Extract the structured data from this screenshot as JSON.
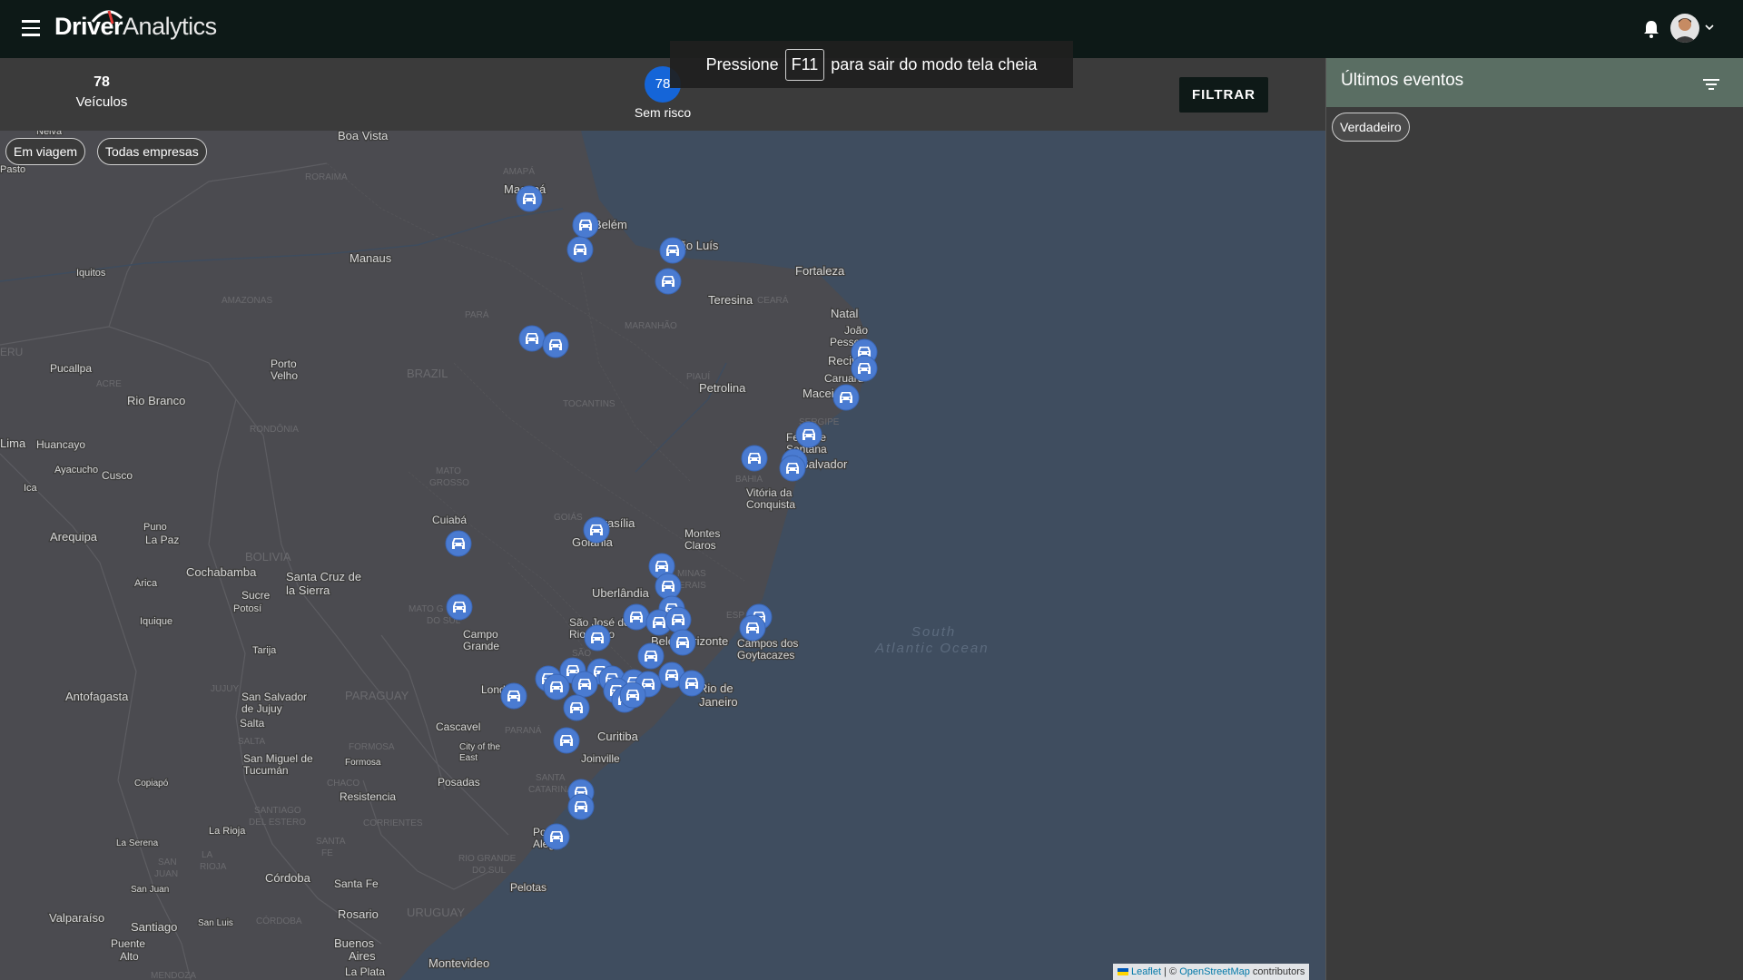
{
  "header": {
    "logo_bold": "Driver",
    "logo_light": "Analytics",
    "icons": [
      "menu-icon",
      "bell-icon",
      "avatar",
      "chevron-down-icon"
    ]
  },
  "stats": {
    "vehicles_count": "78",
    "vehicles_label": "Veículos",
    "risk_count": "78",
    "risk_label": "Sem risco"
  },
  "toolbar": {
    "filter_label": "FILTRAR"
  },
  "fullscreen_notice": {
    "before": "Pressione",
    "key": "F11",
    "after": "para sair do modo tela cheia"
  },
  "map": {
    "chips": [
      "Em viagem",
      "Todas empresas"
    ],
    "attribution": {
      "leaflet": "Leaflet",
      "separator": "| ©",
      "osm": "OpenStreetMap",
      "suffix": "contributors"
    },
    "marker_color": "#4a7bd1",
    "labels_cities": [
      "Boa Vista",
      "Macapá",
      "Belém",
      "São Luís",
      "Fortaleza",
      "Manaus",
      "Iquitos",
      "Teresina",
      "Natal",
      "João Pessoa",
      "Recife",
      "Caruaru",
      "Maceió",
      "Porto Velho",
      "Rio Branco",
      "Pucallpa",
      "Petrolina",
      "Feira de Santana",
      "Salvador",
      "Vitória da Conquista",
      "Lima",
      "Huancayo",
      "Ayacucho",
      "Cusco",
      "Ica",
      "Puno",
      "Cuiabá",
      "Brasília",
      "Goiânia",
      "Montes Claros",
      "Arequipa",
      "La Paz",
      "Cochabamba",
      "Santa Cruz de la Sierra",
      "Arica",
      "Sucre",
      "Potosí",
      "Uberlândia",
      "Iquique",
      "São José do Rio Preto",
      "Belo Horizonte",
      "Campo Grande",
      "Campos dos Goytacazes",
      "Tarija",
      "Antofagasta",
      "San Salvador de Jujuy",
      "Salta",
      "Londrina",
      "Rio de Janeiro",
      "Cascavel",
      "Curitiba",
      "City of the East",
      "Formosa",
      "Joinville",
      "San Miguel de Tucumán",
      "Copiapó",
      "Resistencia",
      "Posadas",
      "Porto Alegre",
      "La Rioja",
      "La Serena",
      "San Juan",
      "Santa Fe",
      "Pelotas",
      "Córdoba",
      "Rosario",
      "Valparaíso",
      "Santiago",
      "San Luis",
      "Puente Alto",
      "Buenos Aires",
      "Montevideo",
      "La Plata",
      "Neiva",
      "Pasto"
    ],
    "labels_regions": [
      "RORAIMA",
      "AMAPÁ",
      "AMAZONAS",
      "PARÁ",
      "MARANHÃO",
      "CEARÁ",
      "BRAZIL",
      "PIAUÍ",
      "ACRE",
      "RONDÔNIA",
      "TOCANTINS",
      "SERGIPE",
      "BAHIA",
      "MATO GROSSO",
      "GOIÁS",
      "BOLIVIA",
      "MINAS GERAIS",
      "MATO GROSSO DO SUL",
      "ESPÍRITO SANTO",
      "SÃO PAULO",
      "JUJUY",
      "PARAGUAY",
      "PARANÁ",
      "SALTA",
      "FORMOSA",
      "CHACO",
      "SANTA CATARINA",
      "SANTIAGO DEL ESTERO",
      "CORRIENTES",
      "RIO GRANDE DO SUL",
      "LA RIOJA",
      "SAN JUAN",
      "SANTA FE",
      "CÓRDOBA",
      "URUGUAY",
      "PERU",
      "MENDOZA"
    ],
    "labels_ocean": [
      "South",
      "Atlantic Ocean"
    ]
  },
  "sidebar": {
    "title": "Últimos eventos",
    "chip": "Verdadeiro"
  }
}
